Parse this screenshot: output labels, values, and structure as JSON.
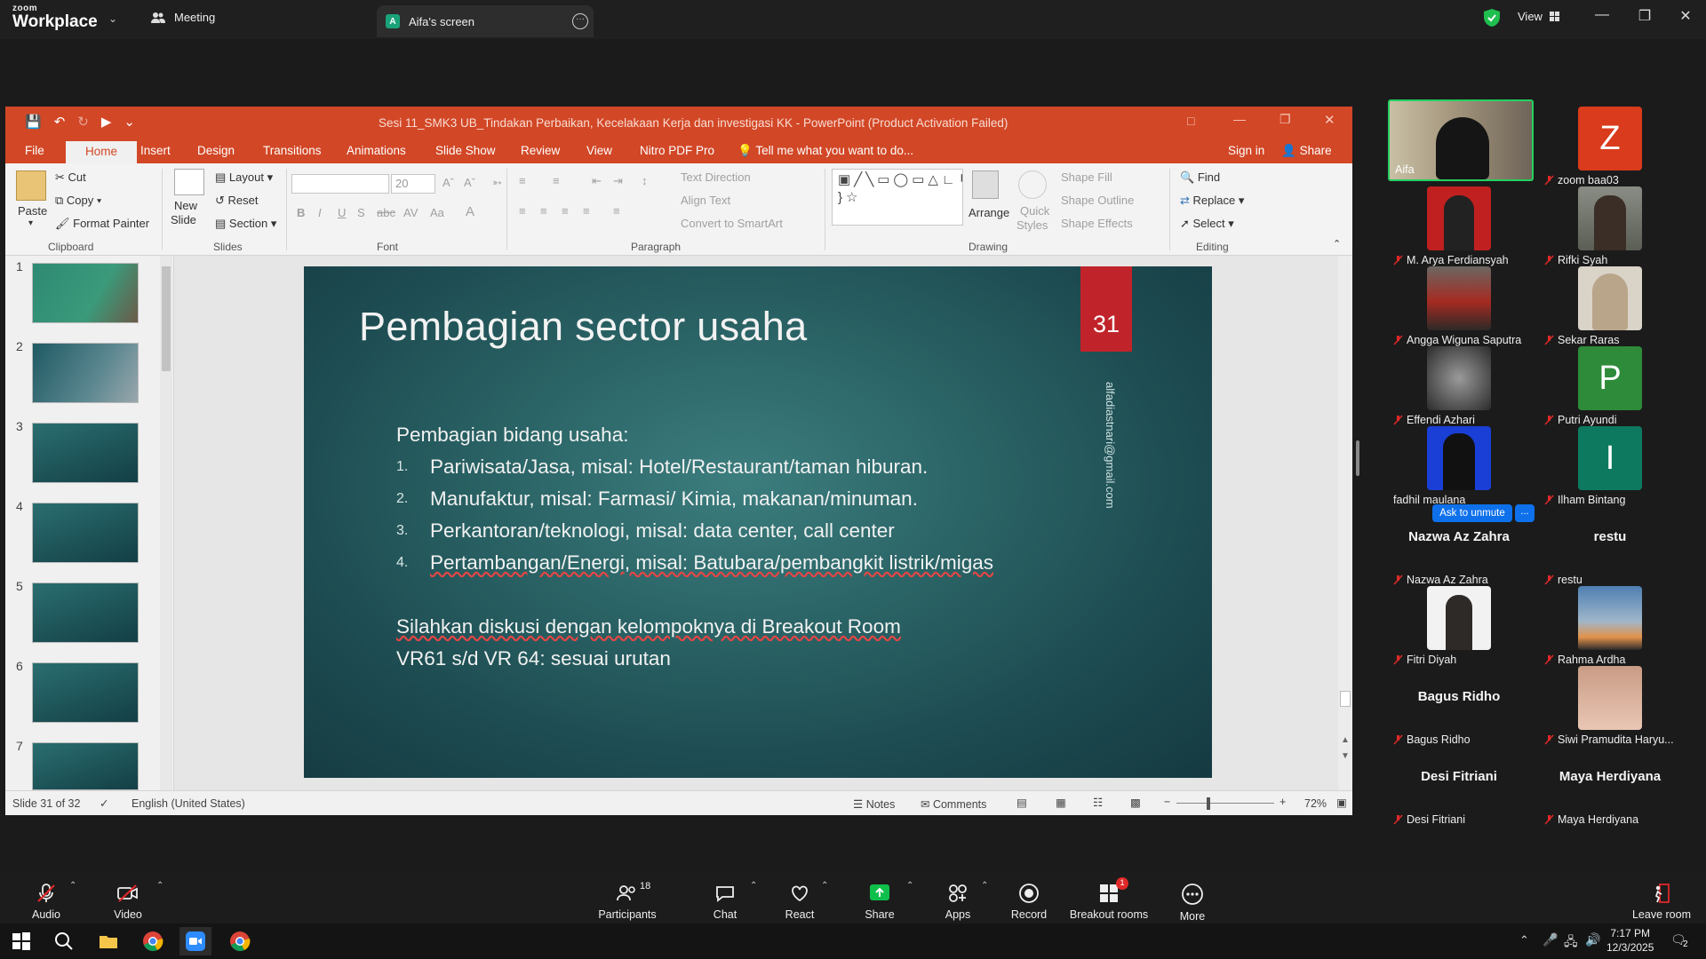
{
  "zoom": {
    "brand_small": "zoom",
    "brand": "Workplace",
    "meeting_tab": "Meeting",
    "screen_tab_initial": "A",
    "screen_tab": "Aifa's screen",
    "view_label": "View"
  },
  "ppt": {
    "window_title": "Sesi 11_SMK3 UB_Tindakan Perbaikan, Kecelakaan Kerja dan investigasi KK - PowerPoint (Product Activation Failed)",
    "tabs": [
      "File",
      "Home",
      "Insert",
      "Design",
      "Transitions",
      "Animations",
      "Slide Show",
      "Review",
      "View",
      "Nitro PDF Pro"
    ],
    "tell_me": "Tell me what you want to do...",
    "sign_in": "Sign in",
    "share": "Share",
    "ribbon": {
      "paste": "Paste",
      "cut": "Cut",
      "copy": "Copy",
      "format_painter": "Format Painter",
      "clipboard": "Clipboard",
      "new_slide_1": "New",
      "new_slide_2": "Slide",
      "layout": "Layout",
      "reset": "Reset",
      "section": "Section",
      "slides": "Slides",
      "font_size": "20",
      "font": "Font",
      "text_direction": "Text Direction",
      "align_text": "Align Text",
      "convert_smartart": "Convert to SmartArt",
      "paragraph": "Paragraph",
      "arrange": "Arrange",
      "quick_styles_1": "Quick",
      "quick_styles_2": "Styles",
      "shape_fill": "Shape Fill",
      "shape_outline": "Shape Outline",
      "shape_effects": "Shape Effects",
      "drawing": "Drawing",
      "find": "Find",
      "replace": "Replace",
      "select": "Select",
      "editing": "Editing"
    },
    "thumb_numbers": [
      "1",
      "2",
      "3",
      "4",
      "5",
      "6",
      "7"
    ],
    "slide": {
      "title": "Pembagian sector usaha",
      "number": "31",
      "email": "alfadiastnari@gmail.com",
      "intro": "Pembagian bidang usaha:",
      "items": [
        {
          "n": "1.",
          "text": "Pariwisata/Jasa, misal: Hotel/Restaurant/taman hiburan."
        },
        {
          "n": "2.",
          "text": "Manufaktur, misal: Farmasi/ Kimia, makanan/minuman."
        },
        {
          "n": "3.",
          "text": "Perkantoran/teknologi, misal: data center, call center"
        },
        {
          "n": "4.",
          "text": "Pertambangan/Energi, misal: Batubara/pembangkit listrik/migas"
        }
      ],
      "line1": "Silahkan diskusi dengan kelompoknya di Breakout Room",
      "line2": "VR61 s/d VR 64: sesuai urutan"
    },
    "status": {
      "slide_of": "Slide 31 of 32",
      "language": "English (United States)",
      "notes": "Notes",
      "comments": "Comments",
      "zoom": "72%"
    }
  },
  "gallery": {
    "participants": [
      {
        "name": "Aifa",
        "type": "active"
      },
      {
        "name": "zoom baa03",
        "letter": "Z",
        "color": "#d93b1c"
      },
      {
        "name": "M. Arya Ferdiansyah",
        "type": "photo"
      },
      {
        "name": "Rifki Syah",
        "type": "photo"
      },
      {
        "name": "Angga Wiguna Saputra",
        "type": "photo"
      },
      {
        "name": "Sekar Raras",
        "type": "photo"
      },
      {
        "name": "Effendi Azhari",
        "type": "photo"
      },
      {
        "name": "Putri Ayundi",
        "letter": "P",
        "color": "#2e8b3a"
      },
      {
        "name": "fadhil maulana",
        "type": "photo"
      },
      {
        "name": "Ilham Bintang",
        "letter": "I",
        "color": "#0d7a5f"
      },
      {
        "name": "Nazwa Az Zahra",
        "type": "name"
      },
      {
        "name": "restu",
        "type": "name"
      },
      {
        "name": "Fitri Diyah",
        "type": "photo"
      },
      {
        "name": "Rahma Ardha",
        "type": "photo"
      },
      {
        "name": "Bagus Ridho",
        "type": "name"
      },
      {
        "name": "Siwi Pramudita Haryu...",
        "type": "photo"
      },
      {
        "name": "Desi Fitriani",
        "type": "name"
      },
      {
        "name": "Maya Herdiyana",
        "type": "name"
      }
    ],
    "ask_unmute": "Ask to unmute",
    "more_dots": "..."
  },
  "toolbar": {
    "audio": "Audio",
    "video": "Video",
    "participants_count": "18",
    "participants": "Participants",
    "chat": "Chat",
    "react": "React",
    "share": "Share",
    "apps": "Apps",
    "record": "Record",
    "breakout_badge": "1",
    "breakout": "Breakout rooms",
    "more": "More",
    "leave": "Leave room"
  },
  "taskbar": {
    "time": "7:17 PM",
    "date": "12/3/2025",
    "notif_count": "2"
  },
  "colors": {
    "ppt_accent": "#d24726",
    "active_speaker": "#23d160",
    "zoom_share_green": "#0fbf4b",
    "ask_unmute_blue": "#0e71eb"
  }
}
